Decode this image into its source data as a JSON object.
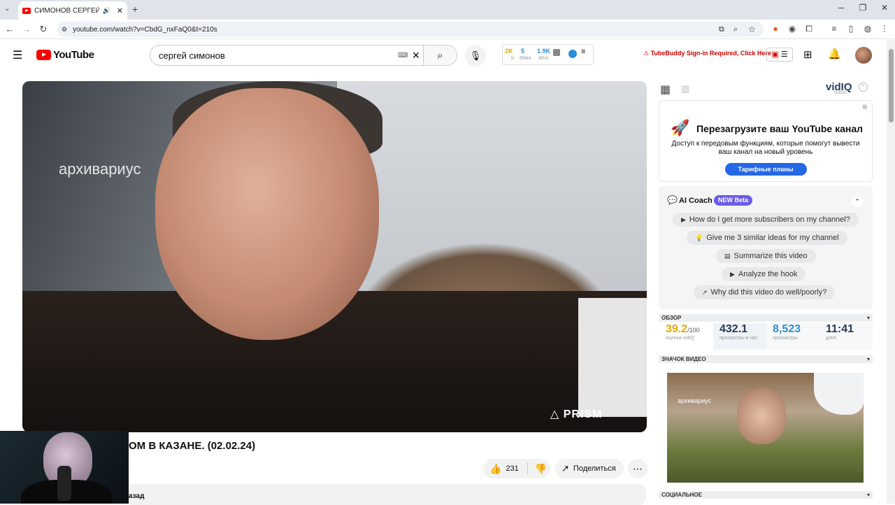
{
  "browser": {
    "tab_title": "СИМОНОВ СЕРГЕЙ - СОМ",
    "url": "youtube.com/watch?v=CbdG_nxFaQ0&t=210s"
  },
  "youtube": {
    "logo": "YouTube",
    "search_value": "сергей симонов",
    "stats": {
      "a": "2K",
      "a_sub": "1г",
      "b": "5",
      "b_sub": "60мн",
      "c": "1.9K",
      "c_sub": "48чс"
    },
    "tubebuddy": "TubeBuddy Sign-in Required, Click Here"
  },
  "video": {
    "watermark": "архивариус",
    "overlay_brand": "PRISM",
    "title": "ОМ В КАЗАНЕ. (02.02.24)",
    "likes": "231",
    "share_label": "Поделиться",
    "desc_snippet": "азад"
  },
  "vidiq": {
    "logo": "vidIQ",
    "plan": "basic",
    "promo_title": "Перезагрузите ваш YouTube канал",
    "promo_sub": "Доступ к передовым функциям, которые помогут вывести ваш канал на новый уровень",
    "promo_btn": "Тарифные планы",
    "coach_title": "AI Coach",
    "coach_badge": "NEW Beta",
    "questions": [
      "How do I get more subscribers on my channel?",
      "Give me 3 similar ideas for my channel",
      "Summarize this video",
      "Analyze the hook",
      "Why did this video do well/poorly?"
    ],
    "overview_label": "ОБЗОР",
    "metrics": [
      {
        "value": "39.2",
        "suffix": "/100",
        "label": "оценка vidIQ"
      },
      {
        "value": "432.1",
        "label": "просмотры в час"
      },
      {
        "value": "8,523",
        "label": "просмотры"
      },
      {
        "value": "11:41",
        "label": "длит."
      }
    ],
    "thumb_label": "ЗНАЧОК ВИДЕО",
    "thumb_watermark": "архивариус",
    "social_label": "СОЦИАЛЬНОЕ"
  }
}
